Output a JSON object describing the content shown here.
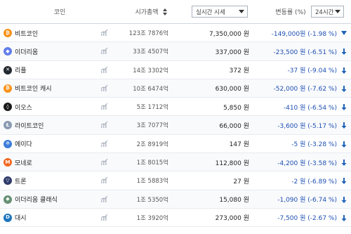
{
  "header": {
    "coin_label": "코인",
    "cap_label": "시가총액",
    "price_select": "실시간 시세",
    "change_label": "변동률 (%)",
    "period_select": "24시간"
  },
  "colors": {
    "change": "#1d4fb3",
    "down_arrow": "#1d62b8"
  },
  "rows": [
    {
      "icon": "bitcoin-icon",
      "symbol": "₿",
      "color": "#f7931a",
      "name": "비트코인",
      "cap": "123조 7876억",
      "price": "7,350,000 원",
      "change": "-149,000원 (-1.98 %)"
    },
    {
      "icon": "ethereum-icon",
      "symbol": "◆",
      "color": "#627eea",
      "name": "이더리움",
      "cap": "33조 4507억",
      "price": "337,000 원",
      "change": "-23,500 원 (-6.51 %)"
    },
    {
      "icon": "ripple-icon",
      "symbol": "✕",
      "color": "#23292f",
      "name": "리플",
      "cap": "14조 3302억",
      "price": "372 원",
      "change": "-37 원 (-9.04 %)"
    },
    {
      "icon": "bitcoin-cash-icon",
      "symbol": "₿",
      "color": "#f7931a",
      "name": "비트코인 캐시",
      "cap": "10조 6474억",
      "price": "630,000 원",
      "change": "-52,000 원 (-7.62 %)"
    },
    {
      "icon": "eos-icon",
      "symbol": "◊",
      "color": "#1a1a1a",
      "name": "이오스",
      "cap": "5조 1712억",
      "price": "5,850 원",
      "change": "-410 원 (-6.54 %)"
    },
    {
      "icon": "litecoin-icon",
      "symbol": "Ł",
      "color": "#8a9bb3",
      "name": "라이트코인",
      "cap": "3조 7077억",
      "price": "66,000 원",
      "change": "-3,600 원 (-5.17 %)"
    },
    {
      "icon": "cardano-icon",
      "symbol": "✲",
      "color": "#3c7dd9",
      "name": "에이다",
      "cap": "2조 8919억",
      "price": "147 원",
      "change": "-5 원 (-3.28 %)"
    },
    {
      "icon": "monero-icon",
      "symbol": "M",
      "color": "#f26822",
      "name": "모네로",
      "cap": "1조 8015억",
      "price": "112,800 원",
      "change": "-4,200 원 (-3.58 %)"
    },
    {
      "icon": "tron-icon",
      "symbol": "▽",
      "color": "#2f3a6b",
      "name": "트론",
      "cap": "1조 5883억",
      "price": "27 원",
      "change": "-2 원 (-6.89 %)"
    },
    {
      "icon": "ethereum-classic-icon",
      "symbol": "◆",
      "color": "#669073",
      "name": "이더리움 클래식",
      "cap": "1조 5350억",
      "price": "15,080 원",
      "change": "-1,090 원 (-6.74 %)"
    },
    {
      "icon": "dash-icon",
      "symbol": "D",
      "color": "#1c75bc",
      "name": "대시",
      "cap": "1조 3920억",
      "price": "273,000 원",
      "change": "-7,500 원 (-2.67 %)"
    }
  ]
}
